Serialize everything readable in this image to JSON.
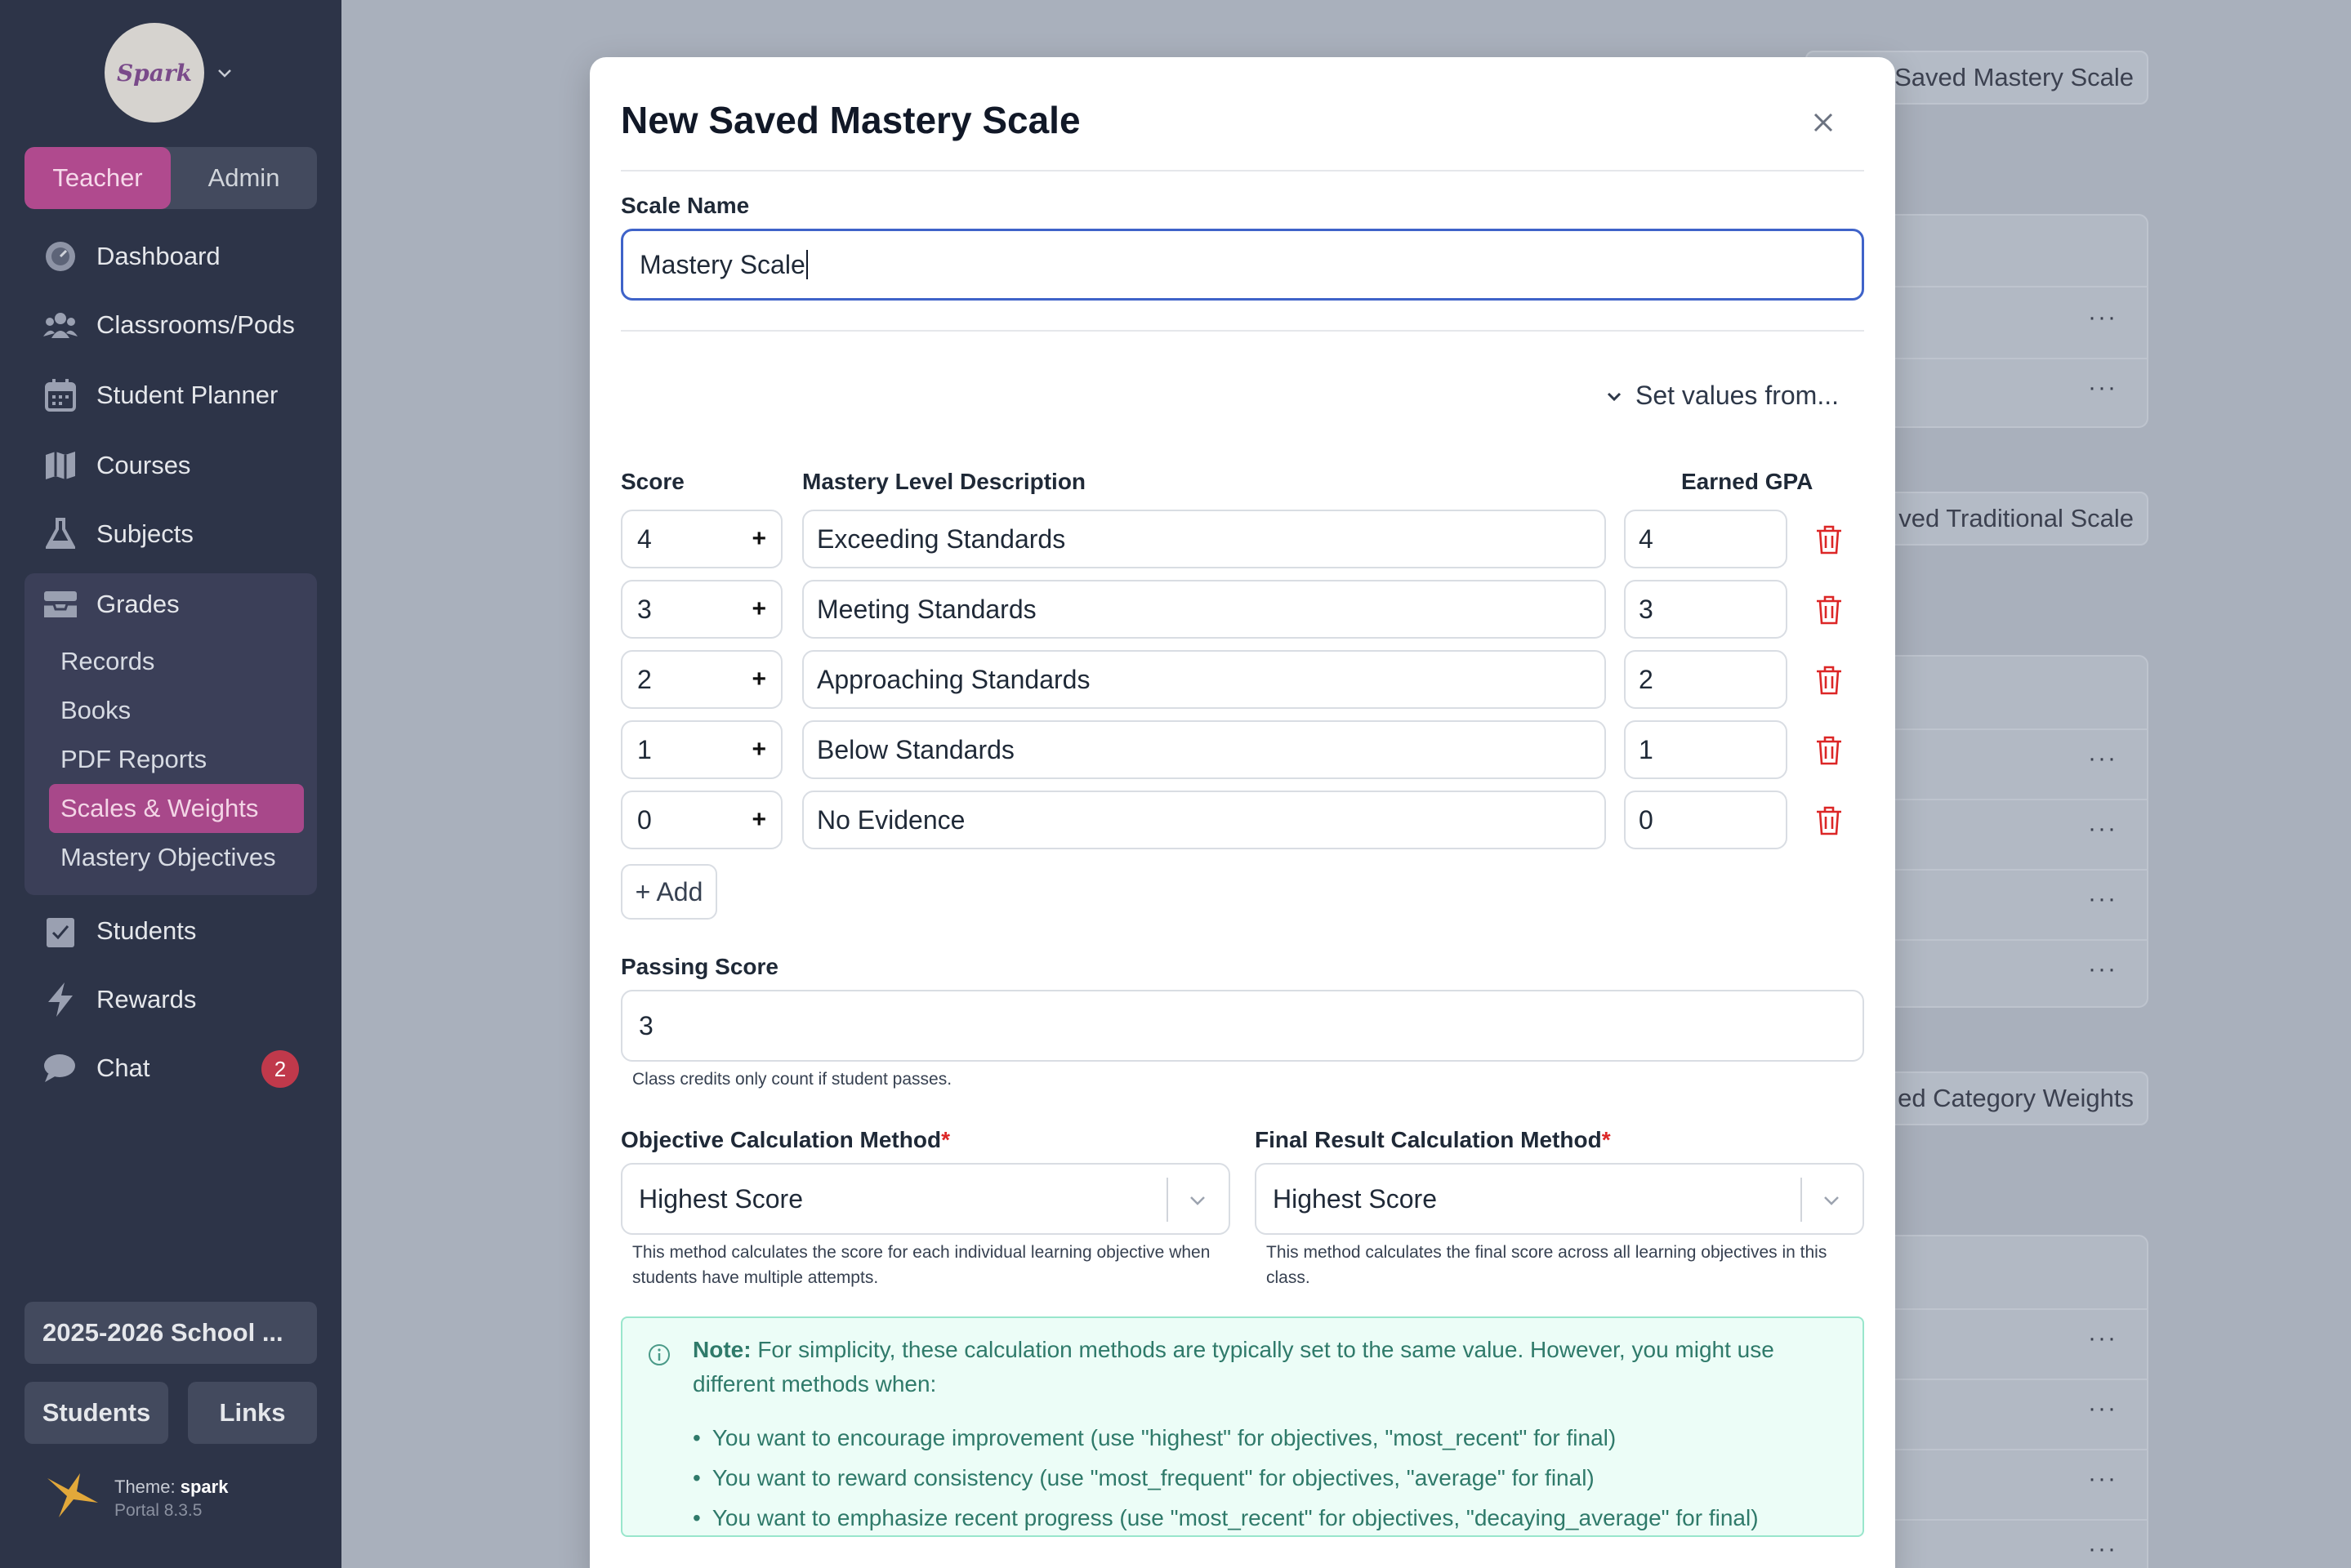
{
  "sidebar": {
    "logo_text": "Spark",
    "roles": [
      "Teacher",
      "Admin"
    ],
    "nav": [
      {
        "label": "Dashboard",
        "icon": "dashboard-icon"
      },
      {
        "label": "Classrooms/Pods",
        "icon": "users-icon"
      },
      {
        "label": "Student Planner",
        "icon": "calendar-icon"
      },
      {
        "label": "Courses",
        "icon": "map-icon"
      },
      {
        "label": "Subjects",
        "icon": "flask-icon"
      },
      {
        "label": "Grades",
        "icon": "inbox-icon"
      },
      {
        "label": "Students",
        "icon": "clipboard-check-icon"
      },
      {
        "label": "Rewards",
        "icon": "bolt-icon"
      },
      {
        "label": "Chat",
        "icon": "chat-icon"
      }
    ],
    "grades_sub": [
      "Records",
      "Books",
      "PDF Reports",
      "Scales & Weights",
      "Mastery Objectives"
    ],
    "chat_count": "2",
    "school_year": "2025-2026 School ...",
    "footer_buttons": [
      "Students",
      "Links"
    ],
    "theme_label": "Theme:",
    "theme_name": "spark",
    "version": "Portal 8.3.5"
  },
  "background": {
    "buttons": [
      "Saved Mastery Scale",
      "ved Traditional Scale",
      "ed Category Weights"
    ]
  },
  "modal": {
    "title": "New Saved Mastery Scale",
    "scale_name_label": "Scale Name",
    "scale_name_value": "Mastery Scale",
    "set_values_label": "Set values from...",
    "columns": {
      "score": "Score",
      "description": "Mastery Level Description",
      "gpa": "Earned GPA"
    },
    "rows": [
      {
        "score": "4",
        "description": "Exceeding Standards",
        "gpa": "4"
      },
      {
        "score": "3",
        "description": "Meeting Standards",
        "gpa": "3"
      },
      {
        "score": "2",
        "description": "Approaching Standards",
        "gpa": "2"
      },
      {
        "score": "1",
        "description": "Below Standards",
        "gpa": "1"
      },
      {
        "score": "0",
        "description": "No Evidence",
        "gpa": "0"
      }
    ],
    "add_label": "+ Add",
    "passing_label": "Passing Score",
    "passing_value": "3",
    "passing_hint": "Class credits only count if student passes.",
    "objective_label": "Objective Calculation Method",
    "objective_value": "Highest Score",
    "objective_hint": "This method calculates the score for each individual learning objective when students have multiple attempts.",
    "final_label": "Final Result Calculation Method",
    "final_value": "Highest Score",
    "final_hint": "This method calculates the final score across all learning objectives in this class.",
    "required_mark": "*",
    "note_bold": "Note:",
    "note_text": " For simplicity, these calculation methods are typically set to the same value. However, you might use different methods when:",
    "note_items": [
      "You want to encourage improvement (use \"highest\" for objectives, \"most_recent\" for final)",
      "You want to reward consistency (use \"most_frequent\" for objectives, \"average\" for final)",
      "You want to emphasize recent progress (use \"most_recent\" for objectives, \"decaying_average\" for final)"
    ]
  },
  "colors": {
    "accent": "#b04a8e",
    "sidebar": "#2d3448",
    "focus": "#3f63c9",
    "danger": "#dc2626",
    "note_bg": "#ecfdf7"
  }
}
